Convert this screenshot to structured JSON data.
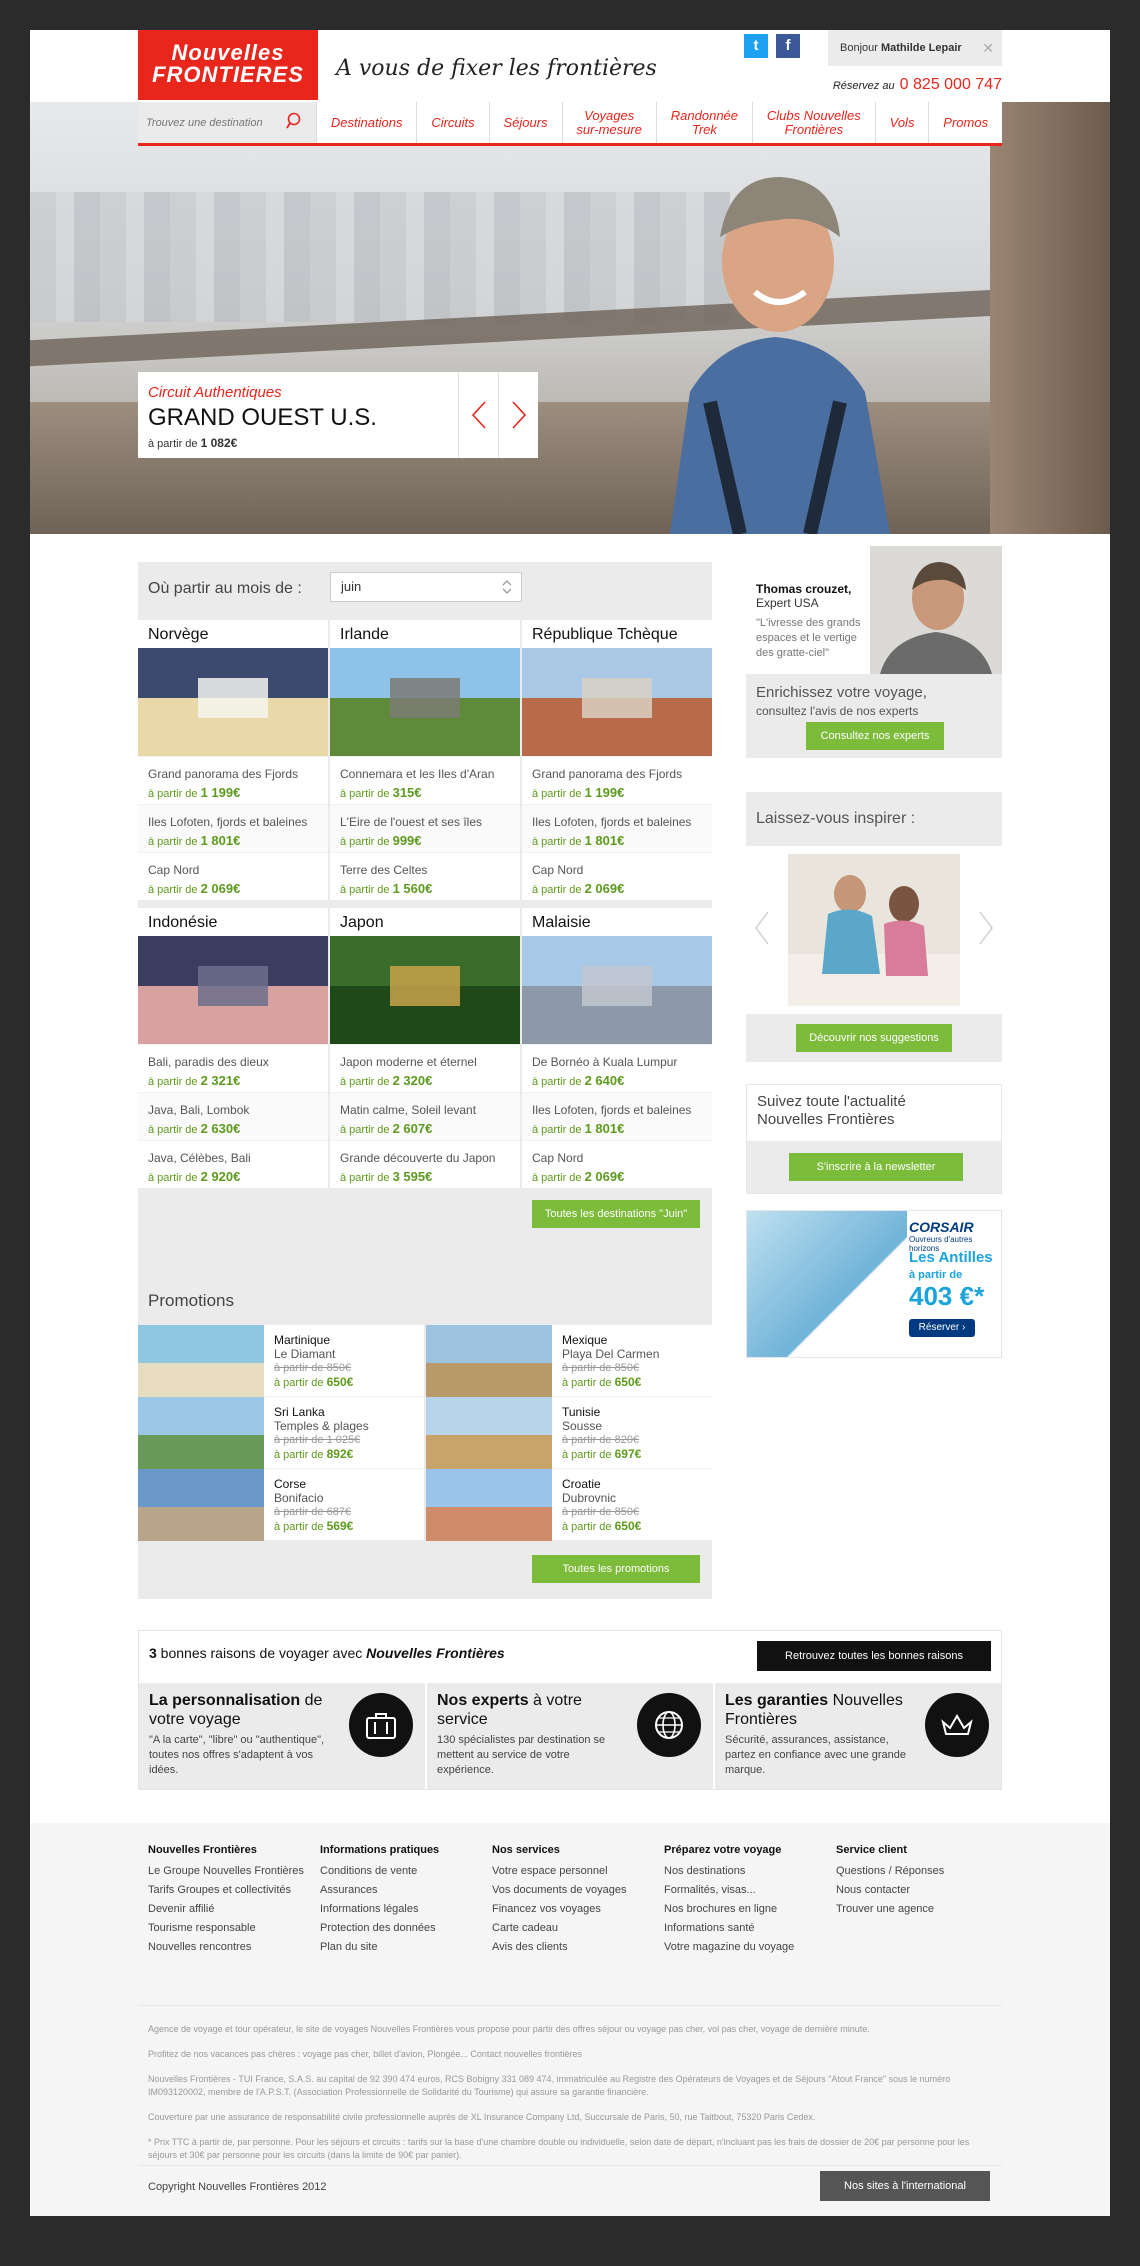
{
  "header": {
    "logo_line1": "Nouvelles",
    "logo_line2": "FRONTIERES",
    "tagline": "A vous de fixer les frontières",
    "welcome_prefix": "Bonjour",
    "user_name": "Mathilde Lepair",
    "reserve_label": "Réservez au",
    "phone": "0 825 000 747"
  },
  "nav": {
    "search_placeholder": "Trouvez une destination",
    "items": [
      "Destinations",
      "Circuits",
      "Séjours",
      "Voyages\nsur-mesure",
      "Randonnée\nTrek",
      "Clubs Nouvelles\nFrontières",
      "Vols",
      "Promos"
    ]
  },
  "hero": {
    "category": "Circuit Authentiques",
    "title": "GRAND OUEST U.S.",
    "price_prefix": "à partir de",
    "price": "1 082€"
  },
  "destinations": {
    "heading": "Où partir au mois de :",
    "month": "juin",
    "countries": [
      {
        "name": "Norvège",
        "offers": [
          {
            "title": "Grand panorama des Fjords",
            "prefix": "à partir de",
            "price": "1 199€"
          },
          {
            "title": "Iles Lofoten, fjords et baleines",
            "prefix": "à partir de",
            "price": "1 801€"
          },
          {
            "title": "Cap Nord",
            "prefix": "à partir de",
            "price": "2 069€"
          }
        ]
      },
      {
        "name": "Irlande",
        "offers": [
          {
            "title": "Connemara et les Iles d'Aran",
            "prefix": "à partir de",
            "price": "315€"
          },
          {
            "title": "L'Eire de l'ouest et ses îles",
            "prefix": "à partir de",
            "price": "999€"
          },
          {
            "title": "Terre des Celtes",
            "prefix": "à partir de",
            "price": "1 560€"
          }
        ]
      },
      {
        "name": "République Tchèque",
        "offers": [
          {
            "title": "Grand panorama des Fjords",
            "prefix": "à partir de",
            "price": "1 199€"
          },
          {
            "title": "Iles Lofoten, fjords et baleines",
            "prefix": "à partir de",
            "price": "1 801€"
          },
          {
            "title": "Cap Nord",
            "prefix": "à partir de",
            "price": "2 069€"
          }
        ]
      },
      {
        "name": "Indonésie",
        "offers": [
          {
            "title": "Bali, paradis des dieux",
            "prefix": "à partir de",
            "price": "2 321€"
          },
          {
            "title": "Java, Bali, Lombok",
            "prefix": "à partir de",
            "price": "2 630€"
          },
          {
            "title": "Java, Célèbes, Bali",
            "prefix": "à partir de",
            "price": "2 920€"
          }
        ]
      },
      {
        "name": "Japon",
        "offers": [
          {
            "title": "Japon moderne et éternel",
            "prefix": "à partir de",
            "price": "2 320€"
          },
          {
            "title": "Matin calme, Soleil levant",
            "prefix": "à partir de",
            "price": "2 607€"
          },
          {
            "title": "Grande découverte du Japon",
            "prefix": "à partir de",
            "price": "3 595€"
          }
        ]
      },
      {
        "name": "Malaisie",
        "offers": [
          {
            "title": "De Bornéo à Kuala Lumpur",
            "prefix": "à partir de",
            "price": "2 640€"
          },
          {
            "title": "Iles Lofoten, fjords et baleines",
            "prefix": "à partir de",
            "price": "1 801€"
          },
          {
            "title": "Cap Nord",
            "prefix": "à partir de",
            "price": "2 069€"
          }
        ]
      }
    ],
    "all_button": "Toutes les destinations \"Juin\""
  },
  "promotions": {
    "heading": "Promotions",
    "items": [
      {
        "place": "Martinique",
        "sub": "Le Diamant",
        "old": "à partir de 850€",
        "new_prefix": "à partir de",
        "new": "650€"
      },
      {
        "place": "Mexique",
        "sub": "Playa Del Carmen",
        "old": "à partir de 850€",
        "new_prefix": "à partir de",
        "new": "650€"
      },
      {
        "place": "Sri Lanka",
        "sub": "Temples & plages",
        "old": "à partir de 1 025€",
        "new_prefix": "à partir de",
        "new": "892€"
      },
      {
        "place": "Tunisie",
        "sub": "Sousse",
        "old": "à partir de 820€",
        "new_prefix": "à partir de",
        "new": "697€"
      },
      {
        "place": "Corse",
        "sub": "Bonifacio",
        "old": "à partir de 687€",
        "new_prefix": "à partir de",
        "new": "569€"
      },
      {
        "place": "Croatie",
        "sub": "Dubrovnic",
        "old": "à partir de 850€",
        "new_prefix": "à partir de",
        "new": "650€"
      }
    ],
    "all_button": "Toutes les promotions"
  },
  "expert": {
    "name": "Thomas crouzet,",
    "role": "Expert USA",
    "quote": "\"L'ivresse des grands espaces et le vertige des gratte-ciel\"",
    "title": "Enrichissez votre voyage,",
    "subtitle": "consultez l'avis de nos experts",
    "button": "Consultez nos experts"
  },
  "inspire": {
    "heading": "Laissez-vous inspirer :",
    "button": "Découvrir nos suggestions"
  },
  "newsletter": {
    "title": "Suivez toute l'actualité Nouvelles Frontières",
    "button": "S'inscrire à la newsletter"
  },
  "ad": {
    "brand": "CORSAIR",
    "brand_sub": "Ouvreurs d'autres horizons",
    "title": "Les Antilles",
    "prefix": "à partir de",
    "price": "403 €*",
    "button": "Réserver"
  },
  "reasons": {
    "title_num": "3",
    "title_text": " bonnes raisons de voyager avec ",
    "title_brand": "Nouvelles Frontières",
    "button": "Retrouvez toutes les bonnes raisons",
    "items": [
      {
        "bold": "La personnalisation",
        "rest": " de votre voyage",
        "desc": "\"A la carte\", \"libre\" ou \"authentique\", toutes nos offres s'adaptent à vos idées.",
        "icon": "luggage-icon"
      },
      {
        "bold": "Nos experts",
        "rest": " à votre service",
        "desc": "130 spécialistes par destination se mettent au service de votre expérience.",
        "icon": "globe-icon"
      },
      {
        "bold": "Les garanties",
        "rest": " Nouvelles Frontières",
        "desc": "Sécurité, assurances, assistance, partez en confiance avec une grande marque.",
        "icon": "crown-icon"
      }
    ]
  },
  "footer": {
    "columns": [
      {
        "heading": "Nouvelles Frontières",
        "links": [
          "Le Groupe Nouvelles Frontières",
          "Tarifs Groupes et collectivités",
          "Devenir affilié",
          "Tourisme responsable",
          "Nouvelles rencontres"
        ]
      },
      {
        "heading": "Informations pratiques",
        "links": [
          "Conditions de vente",
          "Assurances",
          "Informations légales",
          "Protection des données",
          "Plan du site"
        ]
      },
      {
        "heading": "Nos services",
        "links": [
          "Votre espace personnel",
          "Vos documents de voyages",
          "Financez vos voyages",
          "Carte cadeau",
          "Avis des clients"
        ]
      },
      {
        "heading": "Préparez votre voyage",
        "links": [
          "Nos destinations",
          "Formalités, visas...",
          "Nos brochures en ligne",
          "Informations santé",
          "Votre magazine du voyage"
        ]
      },
      {
        "heading": "Service client",
        "links": [
          "Questions / Réponses",
          "Nous contacter",
          "Trouver une agence"
        ]
      }
    ],
    "legal": [
      "Agence de voyage et tour opérateur, le site de voyages Nouvelles Frontières vous propose pour partir des offres séjour ou voyage pas cher, vol pas cher, voyage de dernière minute.",
      "Profitez de nos vacances pas chères : voyage pas cher, billet d'avion, Plongée... Contact nouvelles frontières",
      "Nouvelles Frontières - TUI France, S.A.S. au capital de 92 390 474 euros, RCS Bobigny 331 089 474, immatriculée au Registre des Opérateurs de Voyages et de Séjours \"Atout France\" sous le numéro IM093120002, membre de l'A.P.S.T. (Association Professionnelle de Solidarité du Tourisme) qui assure sa garantie financière.",
      "Couverture par une assurance de responsabilité civile professionnelle auprès de XL Insurance Company Ltd, Succursale de Paris, 50, rue Taitbout, 75320 Paris Cedex.",
      "* Prix TTC à partir de, par personne. Pour les séjours et circuits : tarifs sur la base d'une chambre double ou individuelle, selon date de départ, n'incluant pas les frais de dossier de 20€ par personne pour les séjours et 30€ par personne pour les circuits (dans la limite de 90€ par panier)."
    ],
    "copyright": "Copyright Nouvelles Frontières 2012",
    "intl_button": "Nos sites à l'international"
  }
}
